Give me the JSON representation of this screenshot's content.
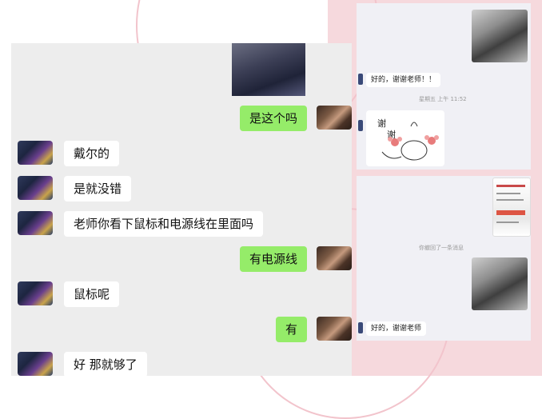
{
  "left_chat": {
    "messages": [
      {
        "side": "out",
        "text": "是这个吗"
      },
      {
        "side": "in",
        "text": "戴尔的"
      },
      {
        "side": "in",
        "text": "是就没错"
      },
      {
        "side": "in",
        "text": "老师你看下鼠标和电源线在里面吗"
      },
      {
        "side": "out",
        "text": "有电源线"
      },
      {
        "side": "in",
        "text": "鼠标呢"
      },
      {
        "side": "out",
        "text": "有"
      },
      {
        "side": "in",
        "text": "好  那就够了"
      }
    ]
  },
  "right_top": {
    "reply": "好的，谢谢老师！！",
    "timestamp": "星期五 上午 11:52",
    "sticker_text_1": "谢",
    "sticker_text_2": "谢"
  },
  "right_bottom": {
    "recall_notice": "你撤回了一条消息",
    "reply": "好的，谢谢老师"
  },
  "colors": {
    "outgoing_bubble": "#95ec69",
    "incoming_bubble": "#ffffff",
    "chat_bg": "#ededed",
    "pink_bg": "#f6d9dd"
  }
}
